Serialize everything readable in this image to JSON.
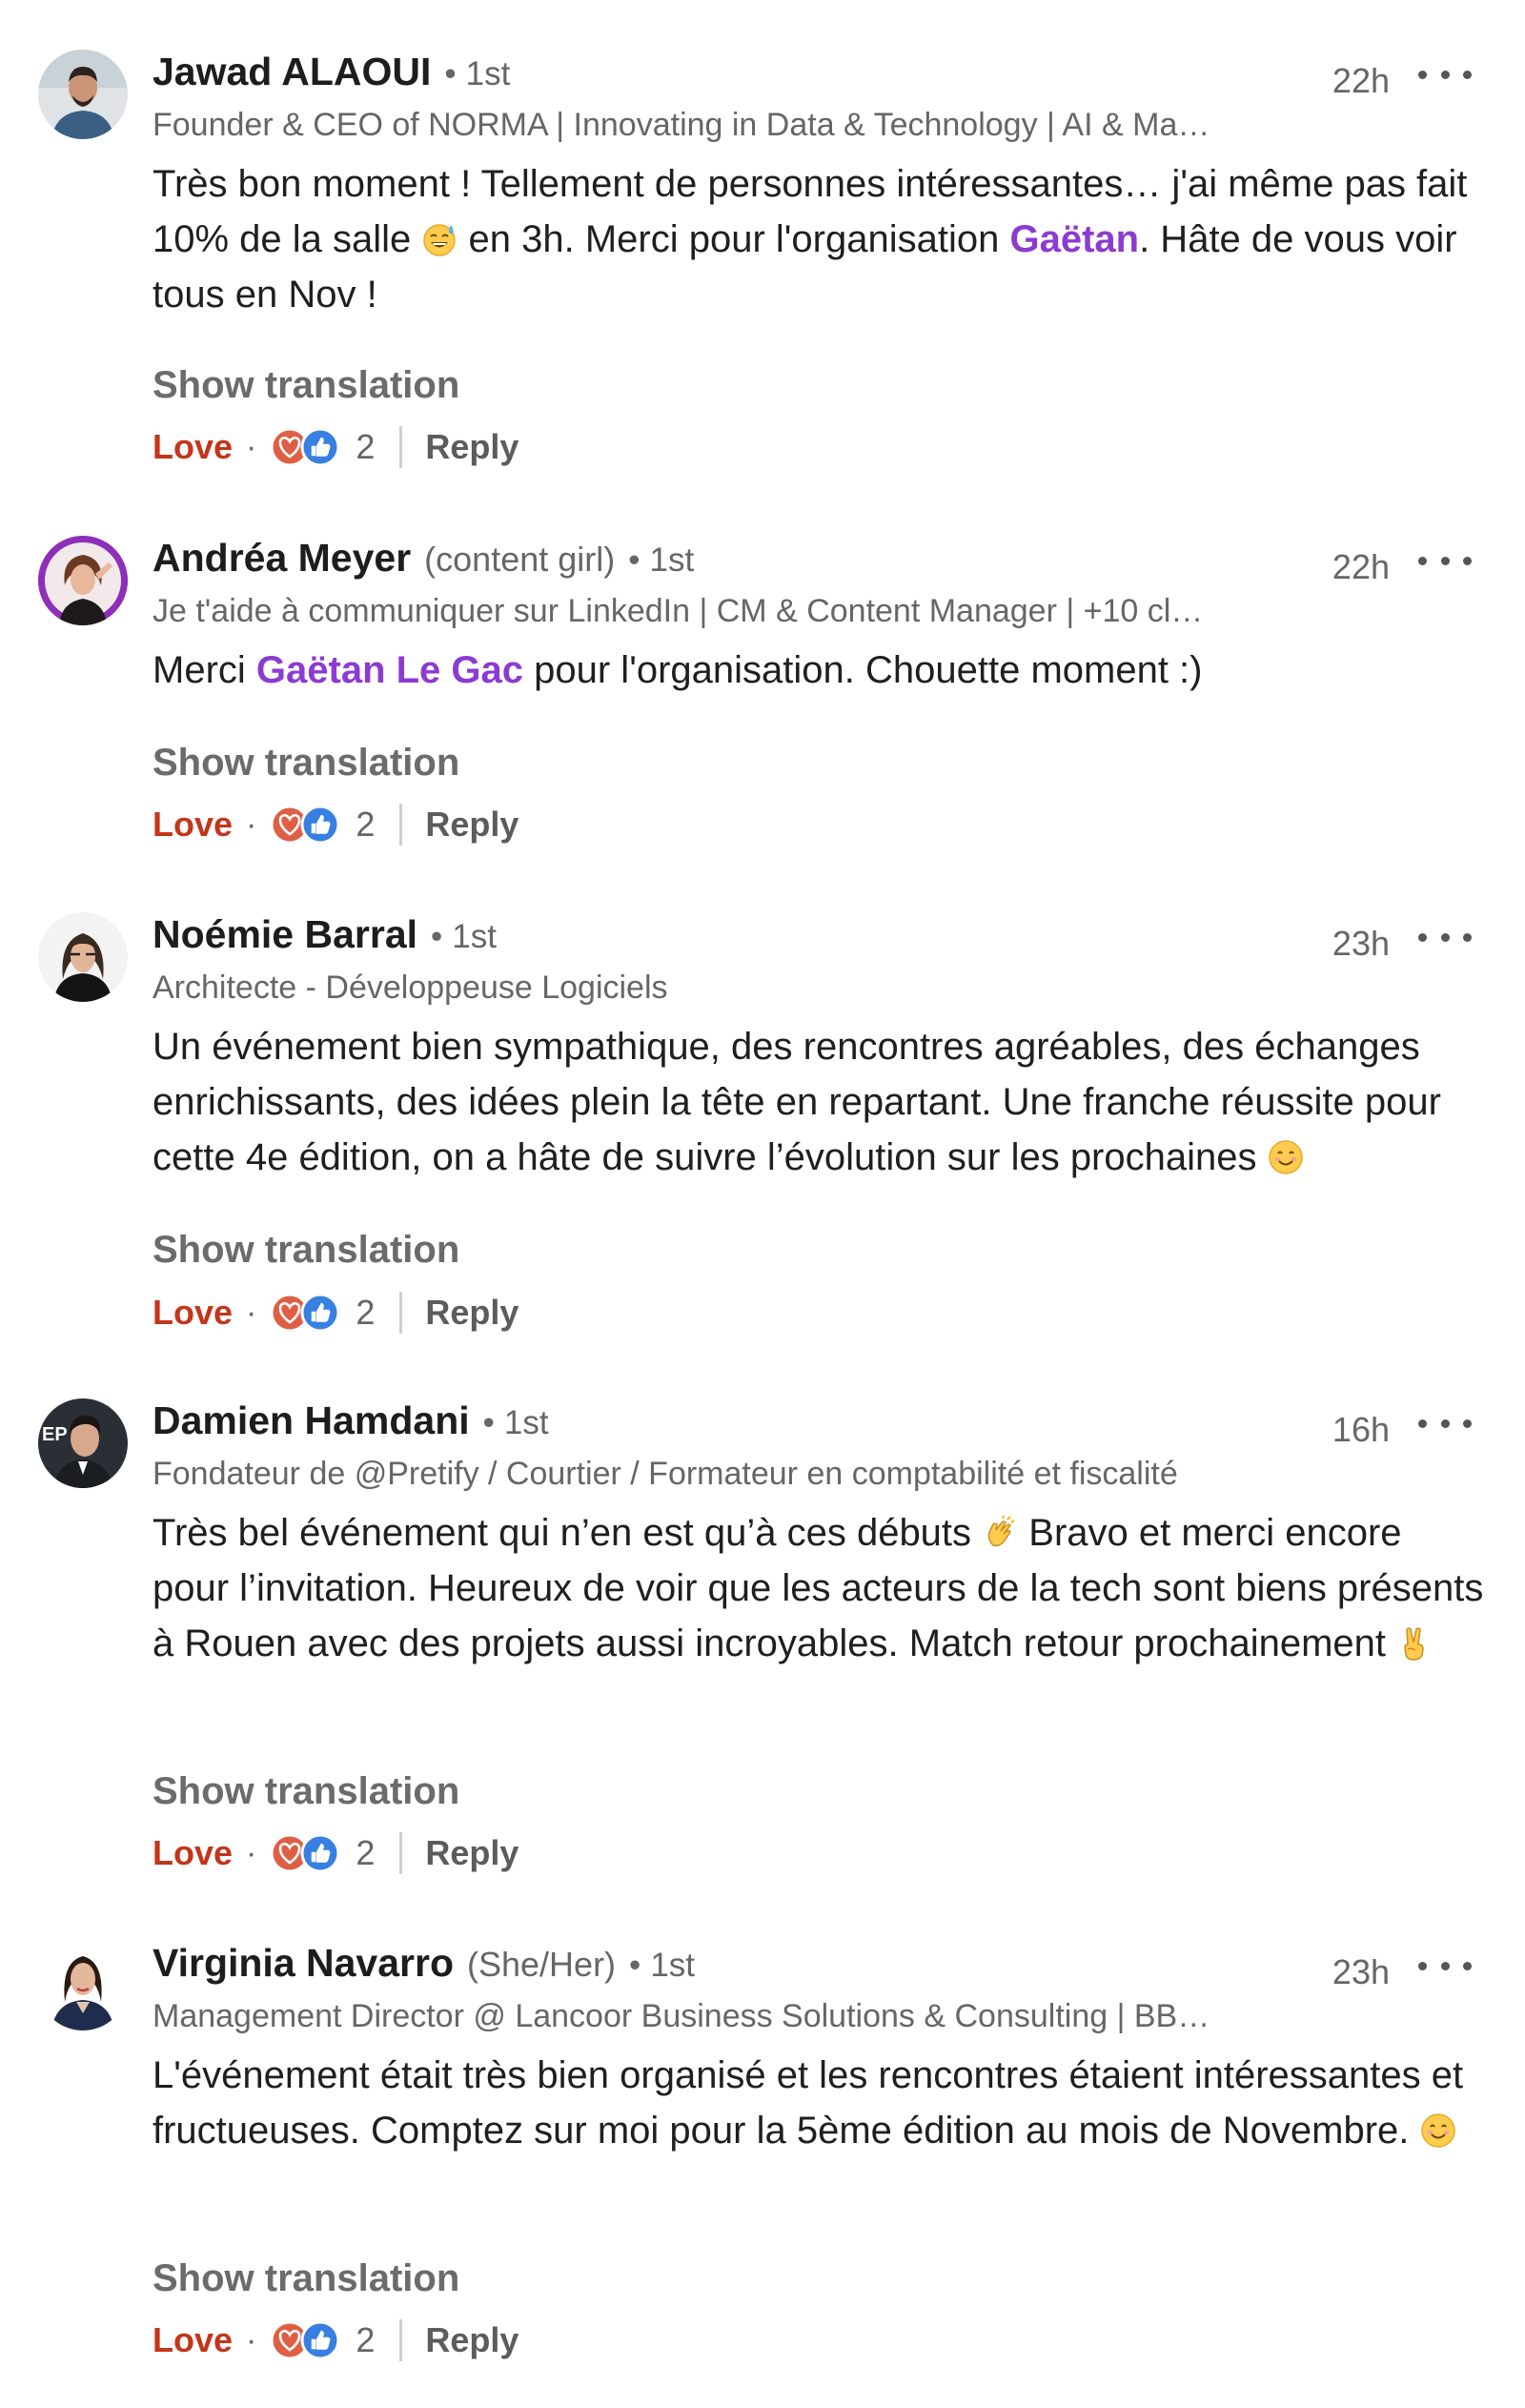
{
  "colors": {
    "mention": "#8c3bd1",
    "love": "#c4351a",
    "secondary_text": "#666666",
    "like_blue": "#3780e2",
    "love_red": "#df5f44"
  },
  "comments": [
    {
      "author": "Jawad ALAOUI",
      "pronoun": "",
      "degree": "1st",
      "time": "22h",
      "headline": "Founder & CEO of NORMA | Innovating in Data & Technology | AI & Ma…",
      "body": {
        "p1": "Très bon moment ! Tellement de personnes intéressantes… j'ai même pas fait 10% de la salle ",
        "emoji": "grinning-sweat-emoji",
        "p2": " en 3h. Merci pour l'organisation ",
        "mention": "Gaëtan",
        "p3": ". Hâte de vous voir tous en Nov !"
      },
      "show_translation": "Show translation",
      "love": "Love",
      "dot": "·",
      "reaction_count": "2",
      "reply": "Reply"
    },
    {
      "author": "Andréa Meyer",
      "pronoun": "(content girl)",
      "degree": "1st",
      "time": "22h",
      "headline": "Je t'aide à communiquer sur LinkedIn | CM & Content Manager | +10 cl…",
      "body": {
        "p1": "Merci ",
        "mention": "Gaëtan Le Gac",
        "p2": " pour l'organisation. Chouette moment :)"
      },
      "show_translation": "Show translation",
      "love": "Love",
      "dot": "·",
      "reaction_count": "2",
      "reply": "Reply"
    },
    {
      "author": "Noémie Barral",
      "pronoun": "",
      "degree": "1st",
      "time": "23h",
      "headline": "Architecte - Développeuse Logiciels",
      "body": {
        "p1": "Un événement bien sympathique, des rencontres agréables, des échanges enrichissants, des idées plein la tête en repartant. Une franche réussite pour cette 4e édition, on a hâte de suivre l’évolution sur les prochaines ",
        "emoji": "smiling-face-emoji"
      },
      "show_translation": "Show translation",
      "love": "Love",
      "dot": "·",
      "reaction_count": "2",
      "reply": "Reply"
    },
    {
      "author": "Damien Hamdani",
      "pronoun": "",
      "degree": "1st",
      "time": "16h",
      "headline": "Fondateur de @Pretify / Courtier / Formateur en comptabilité et fiscalité",
      "body": {
        "p1": "Très bel événement qui n’en est qu’à ces débuts ",
        "emoji": "clapping-hands-emoji",
        "p2": " Bravo et merci encore pour l’invitation. Heureux de voir que les acteurs de la tech sont biens présents à Rouen avec des projets aussi incroyables. Match retour prochainement ",
        "emoji2": "victory-hand-emoji"
      },
      "show_translation": "Show translation",
      "love": "Love",
      "dot": "·",
      "reaction_count": "2",
      "reply": "Reply"
    },
    {
      "author": "Virginia Navarro",
      "pronoun": "(She/Her)",
      "degree": "1st",
      "time": "23h",
      "headline": "Management Director @ Lancoor Business Solutions & Consulting | BB…",
      "body": {
        "p1": "L'événement était très bien organisé et les rencontres étaient intéressantes et fructueuses. Comptez sur moi pour la 5ème édition au mois de Novembre. ",
        "emoji": "smiling-face-emoji"
      },
      "show_translation": "Show translation",
      "love": "Love",
      "dot": "·",
      "reaction_count": "2",
      "reply": "Reply"
    }
  ]
}
